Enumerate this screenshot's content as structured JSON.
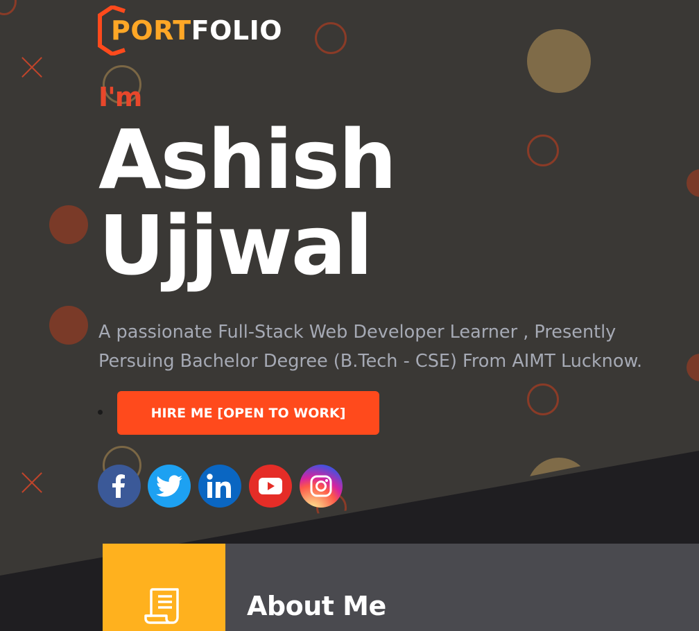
{
  "logo": {
    "part1": "PORT",
    "part2": "FOLIO"
  },
  "hero": {
    "greeting": "I'm",
    "first_name": "Ashish",
    "last_name": "Ujjwal",
    "tagline_line1": "A passionate Full-Stack Web Developer Learner , Presently",
    "tagline_line2": "Persuing Bachelor Degree (B.Tech - CSE) From AIMT Lucknow."
  },
  "cta": {
    "hire_label": "HIRE ME [OPEN TO WORK]"
  },
  "social": [
    {
      "name": "facebook-icon",
      "color": "#3b5998"
    },
    {
      "name": "twitter-icon",
      "color": "#1da1f2"
    },
    {
      "name": "linkedin-icon",
      "color": "#0a66c2"
    },
    {
      "name": "youtube-icon",
      "color": "#e52d27"
    },
    {
      "name": "instagram-icon",
      "color": "#d6249f"
    }
  ],
  "about": {
    "title": "About Me",
    "icon": "document-icon"
  },
  "colors": {
    "accent": "#ff4a1c",
    "logo_accent": "#ffa726",
    "about_accent": "#ffb11e",
    "background": "#3a3835"
  }
}
